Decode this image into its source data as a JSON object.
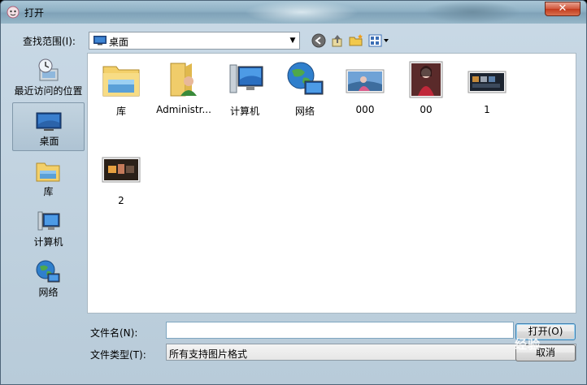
{
  "window": {
    "title": "打开",
    "close_symbol": "✕"
  },
  "toolbar": {
    "look_in_label": "查找范围(I):",
    "look_in_value": "桌面",
    "back_icon": "back-icon",
    "up_icon": "up-folder-icon",
    "new_folder_icon": "new-folder-icon",
    "views_icon": "views-menu-icon"
  },
  "places": [
    {
      "label": "最近访问的位置",
      "icon": "recent-places-icon",
      "active": false
    },
    {
      "label": "桌面",
      "icon": "desktop-icon",
      "active": true
    },
    {
      "label": "库",
      "icon": "libraries-icon",
      "active": false
    },
    {
      "label": "计算机",
      "icon": "computer-icon",
      "active": false
    },
    {
      "label": "网络",
      "icon": "network-icon",
      "active": false
    }
  ],
  "files": [
    {
      "label": "库",
      "icon": "libraries-folder-icon"
    },
    {
      "label": "Administr...",
      "icon": "user-folder-icon"
    },
    {
      "label": "计算机",
      "icon": "computer-icon"
    },
    {
      "label": "网络",
      "icon": "network-icon"
    },
    {
      "label": "000",
      "icon": "image-thumbnail-icon"
    },
    {
      "label": "00",
      "icon": "image-thumbnail-icon"
    },
    {
      "label": "1",
      "icon": "image-thumbnail-icon"
    },
    {
      "label": "2",
      "icon": "image-thumbnail-icon"
    }
  ],
  "bottom": {
    "file_name_label": "文件名(N):",
    "file_name_value": "",
    "file_type_label": "文件类型(T):",
    "file_type_value": "所有支持图片格式",
    "open_label": "打开(O)",
    "cancel_label": "取消"
  },
  "watermark": "经验",
  "colors": {
    "accent": "#3c7fb1",
    "close": "#c23b1d"
  }
}
